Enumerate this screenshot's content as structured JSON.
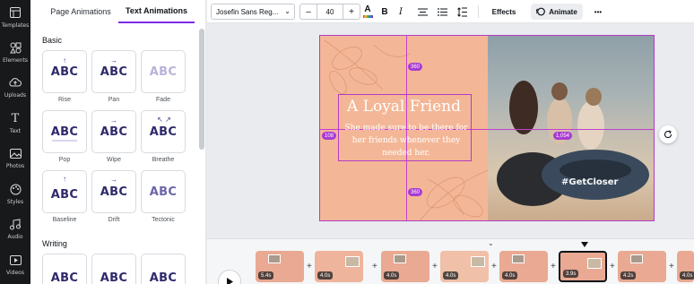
{
  "rail": {
    "items": [
      {
        "label": "Templates",
        "icon": "templates-icon"
      },
      {
        "label": "Elements",
        "icon": "elements-icon"
      },
      {
        "label": "Uploads",
        "icon": "uploads-icon"
      },
      {
        "label": "Text",
        "icon": "text-icon"
      },
      {
        "label": "Photos",
        "icon": "photos-icon"
      },
      {
        "label": "Styles",
        "icon": "styles-icon"
      },
      {
        "label": "Audio",
        "icon": "audio-icon"
      },
      {
        "label": "Videos",
        "icon": "videos-icon"
      }
    ]
  },
  "panel": {
    "tabs": [
      {
        "label": "Page Animations",
        "active": false
      },
      {
        "label": "Text Animations",
        "active": true
      }
    ],
    "sections": [
      {
        "title": "Basic"
      },
      {
        "title": "Writing"
      }
    ],
    "animations": [
      {
        "label": "Rise",
        "sample": "ABC",
        "mark": "↑"
      },
      {
        "label": "Pan",
        "sample": "ABC",
        "mark": "→"
      },
      {
        "label": "Fade",
        "sample": "ABC",
        "mark": ""
      },
      {
        "label": "Pop",
        "sample": "ABC",
        "mark": ""
      },
      {
        "label": "Wipe",
        "sample": "ABC",
        "mark": "→"
      },
      {
        "label": "Breathe",
        "sample": "ABC",
        "mark": "↖ ↗"
      },
      {
        "label": "Baseline",
        "sample": "ABC",
        "mark": "↑"
      },
      {
        "label": "Drift",
        "sample": "ABC",
        "mark": "→"
      },
      {
        "label": "Tectonic",
        "sample": "ABC",
        "mark": ""
      },
      {
        "label": "",
        "sample": "ABC",
        "mark": ""
      },
      {
        "label": "",
        "sample": "ABC",
        "mark": ""
      },
      {
        "label": "",
        "sample": "ABC",
        "mark": ""
      }
    ]
  },
  "toolbar": {
    "font_family": "Josefin Sans Reg...",
    "font_size": "40",
    "minus": "–",
    "plus": "+",
    "text_color_glyph": "A",
    "bold": "B",
    "italic": "I",
    "effects": "Effects",
    "animate": "Animate",
    "more": "•••"
  },
  "canvas": {
    "headline": "A Loyal Friend",
    "body": "She made sure to be there for her friends whenever they needed her.",
    "photo_text": "#GetCloser",
    "measure_top": "360",
    "measure_bottom": "360",
    "measure_left": "108",
    "measure_right": "1,054",
    "accent": "#a93bd3",
    "left_bg": "#f3b797"
  },
  "timeline": {
    "collapse_glyph": "⌄",
    "clips": [
      {
        "duration": "5.4s",
        "active": false
      },
      {
        "duration": "4.0s",
        "active": false
      },
      {
        "duration": "4.0s",
        "active": false
      },
      {
        "duration": "4.0s",
        "active": false
      },
      {
        "duration": "4.0s",
        "active": false
      },
      {
        "duration": "3.9s",
        "active": true
      },
      {
        "duration": "4.2s",
        "active": false
      },
      {
        "duration": "4.0s",
        "active": false
      }
    ]
  }
}
